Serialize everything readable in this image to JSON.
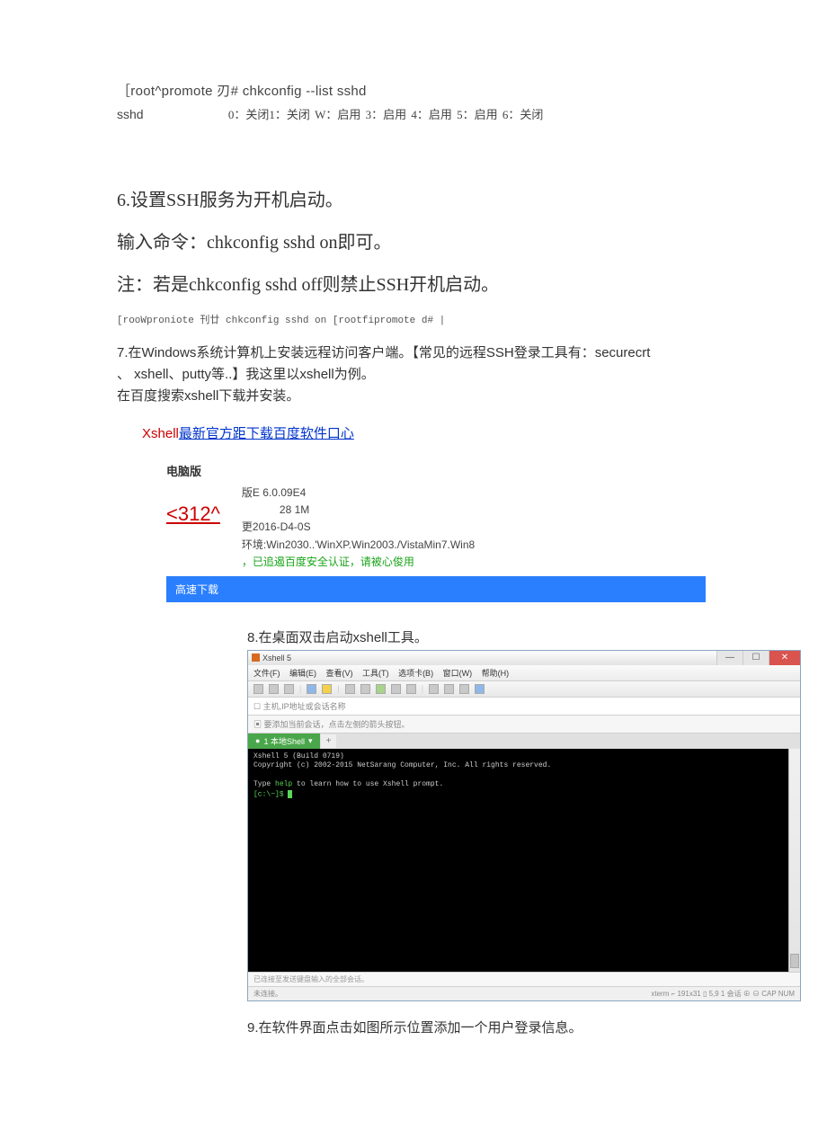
{
  "term1": {
    "line1": "［root^promote 刃# chkconfig --list sshd",
    "line2_prefix": "sshd",
    "line2_rest": "0：关闭1：关闭 W：启用 3：启用 4：启用 5：启用 6：关闭"
  },
  "step6": {
    "title": "6.设置SSH服务为开机启动。",
    "p1": "输入命令：chkconfig sshd on即可。",
    "p2": "注：若是chkconfig sshd off则禁止SSH开机启动。",
    "code": "[rooWproniote 刊廿 chkconfig sshd on [rootfipromote d# |"
  },
  "step7": {
    "line1": "7.在Windows系统计算机上安装远程访问客户端。【常见的远程SSH登录工具有：securecrt",
    "line2": "、 xshell、putty等..】我这里以xshell为例。",
    "line3": "在百度搜索xshell下载并安装。"
  },
  "xlink": {
    "red": "Xshell",
    "blue": "最新官方距下载百度软件口心"
  },
  "pcver": "电脑版",
  "icon": "<312^",
  "meta": {
    "l1": "版E  6.0.09E4",
    "l2": "28 1M",
    "l3": "更2016-D4-0S",
    "l4": "环境:Win2030..'WinXP.Win2003./VistaMin7.Win8",
    "l5": "，已追遏百度安全认证，请被心俊用"
  },
  "dlbtn": "高速下载",
  "step8title": "8.在桌面双击启动xshell工具。",
  "xw": {
    "title": "Xshell 5",
    "menu": [
      "文件(F)",
      "编辑(E)",
      "查看(V)",
      "工具(T)",
      "选项卡(B)",
      "窗口(W)",
      "帮助(H)"
    ],
    "addr1": "主机,IP地址或会话名称",
    "addr2": "要添加当前会话，点击左侧的箭头按钮。",
    "tab": "1 本地Shell",
    "term_l1": "Xshell 5 (Build 0719)",
    "term_l2": "Copyright (c) 2002-2015 NetSarang Computer, Inc. All rights reserved.",
    "term_l3a": "Type ",
    "term_l3b": "help",
    "term_l3c": "  to learn how to use Xshell prompt.",
    "term_l4": "[c:\\~]$ ",
    "status1": "已连接至发送键盘输入的全部会话。",
    "status2_left": "未连接。",
    "status2_right": "xterm   ⌐ 191x31   ▯ 5,9   1 会话   ⊕ ⊖   CAP NUM"
  },
  "step9": "9.在软件界面点击如图所示位置添加一个用户登录信息。"
}
